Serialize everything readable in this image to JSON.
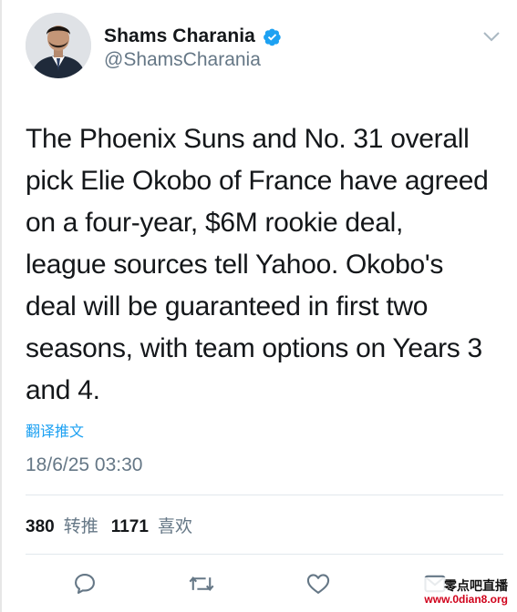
{
  "tweet": {
    "author": {
      "name": "Shams Charania",
      "handle": "@ShamsCharania",
      "verified": true,
      "avatar_icon": "profile-photo"
    },
    "text": "The Phoenix Suns and No. 31 overall\npick Elie Okobo of France have agreed\non a four-year, $6M rookie deal,\nleague sources tell Yahoo. Okobo's\ndeal will be guaranteed in first two\nseasons, with team options on Years 3\nand 4.",
    "translate_label": "翻译推文",
    "timestamp": "18/6/25 03:30",
    "stats": {
      "retweets_count": "380",
      "retweets_label": "转推",
      "likes_count": "1171",
      "likes_label": "喜欢"
    },
    "actions": [
      "reply-icon",
      "retweet-icon",
      "like-icon",
      "direct-message-icon"
    ]
  },
  "watermark": {
    "text": "零点吧直播",
    "url": "www.0dian8.org"
  },
  "colors": {
    "accent": "#1da1f2",
    "text_primary": "#14171a",
    "text_secondary": "#657786",
    "watermark_url": "#d0021b"
  }
}
